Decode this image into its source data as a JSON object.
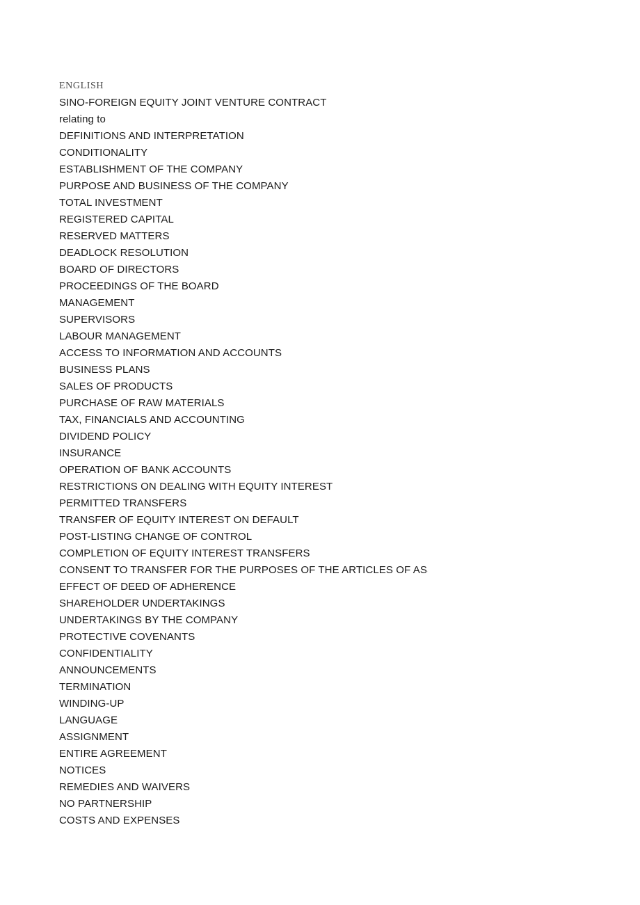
{
  "document": {
    "language_marker": "ENGLISH",
    "title": "SINO-FOREIGN EQUITY JOINT VENTURE CONTRACT",
    "subtitle": "relating to",
    "colors": {
      "page_background": "#ffffff",
      "body_text": "#1a1a1a",
      "marker_text": "#4a4a4a"
    },
    "contents": [
      {
        "label": "DEFINITIONS AND INTERPRETATION",
        "clipped": false
      },
      {
        "label": "CONDITIONALITY",
        "clipped": false
      },
      {
        "label": "ESTABLISHMENT OF THE COMPANY",
        "clipped": false
      },
      {
        "label": "PURPOSE AND BUSINESS OF THE COMPANY",
        "clipped": false
      },
      {
        "label": "TOTAL INVESTMENT",
        "clipped": false
      },
      {
        "label": "REGISTERED CAPITAL",
        "clipped": false
      },
      {
        "label": "RESERVED MATTERS",
        "clipped": false
      },
      {
        "label": "DEADLOCK RESOLUTION",
        "clipped": false
      },
      {
        "label": "BOARD OF DIRECTORS",
        "clipped": false
      },
      {
        "label": "PROCEEDINGS OF THE BOARD",
        "clipped": false
      },
      {
        "label": "MANAGEMENT",
        "clipped": false
      },
      {
        "label": "SUPERVISORS",
        "clipped": false
      },
      {
        "label": "LABOUR MANAGEMENT",
        "clipped": false
      },
      {
        "label": "ACCESS TO INFORMATION AND ACCOUNTS",
        "clipped": false
      },
      {
        "label": "BUSINESS PLANS",
        "clipped": false
      },
      {
        "label": "SALES OF PRODUCTS",
        "clipped": false
      },
      {
        "label": "PURCHASE OF RAW MATERIALS",
        "clipped": false
      },
      {
        "label": "TAX, FINANCIALS AND ACCOUNTING",
        "clipped": false
      },
      {
        "label": "DIVIDEND POLICY",
        "clipped": false
      },
      {
        "label": "INSURANCE",
        "clipped": false
      },
      {
        "label": "OPERATION OF BANK ACCOUNTS",
        "clipped": false
      },
      {
        "label": "RESTRICTIONS ON DEALING WITH EQUITY INTEREST",
        "clipped": false
      },
      {
        "label": "PERMITTED TRANSFERS",
        "clipped": false
      },
      {
        "label": "TRANSFER OF EQUITY INTEREST ON DEFAULT",
        "clipped": false
      },
      {
        "label": "POST-LISTING CHANGE OF CONTROL",
        "clipped": false
      },
      {
        "label": "COMPLETION OF EQUITY INTEREST TRANSFERS",
        "clipped": false
      },
      {
        "label": "CONSENT TO TRANSFER FOR THE PURPOSES OF THE ARTICLES OF ASSOCIATION",
        "clipped": true
      },
      {
        "label": "EFFECT OF DEED OF ADHERENCE",
        "clipped": false
      },
      {
        "label": "SHAREHOLDER UNDERTAKINGS",
        "clipped": false
      },
      {
        "label": "UNDERTAKINGS BY THE COMPANY",
        "clipped": false
      },
      {
        "label": "PROTECTIVE COVENANTS",
        "clipped": false
      },
      {
        "label": "CONFIDENTIALITY",
        "clipped": false
      },
      {
        "label": "ANNOUNCEMENTS",
        "clipped": false
      },
      {
        "label": "TERMINATION",
        "clipped": false
      },
      {
        "label": "WINDING-UP",
        "clipped": false
      },
      {
        "label": "LANGUAGE",
        "clipped": false
      },
      {
        "label": "ASSIGNMENT",
        "clipped": false
      },
      {
        "label": "ENTIRE AGREEMENT",
        "clipped": false
      },
      {
        "label": "NOTICES",
        "clipped": false
      },
      {
        "label": "REMEDIES AND WAIVERS",
        "clipped": false
      },
      {
        "label": "NO PARTNERSHIP",
        "clipped": false
      },
      {
        "label": "COSTS AND EXPENSES",
        "clipped": false
      }
    ]
  }
}
